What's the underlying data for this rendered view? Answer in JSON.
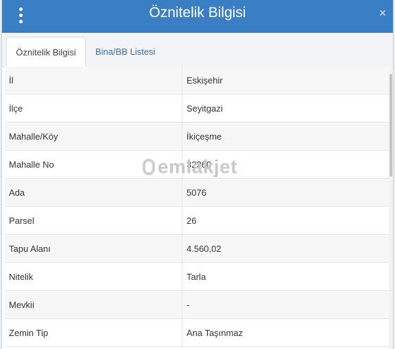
{
  "header": {
    "title": "Öznitelik Bilgisi",
    "close_glyph": "×",
    "menu_icon": "vertical-dots-icon"
  },
  "tabs": [
    {
      "label": "Öznitelik Bilgisi",
      "active": true
    },
    {
      "label": "Bina/BB Listesi",
      "active": false
    }
  ],
  "rows": [
    {
      "key": "İl",
      "value": "Eskişehir"
    },
    {
      "key": "İlçe",
      "value": "Seyitgazi"
    },
    {
      "key": "Mahalle/Köy",
      "value": "İkiçeşme"
    },
    {
      "key": "Mahalle No",
      "value": "32260"
    },
    {
      "key": "Ada",
      "value": "5076"
    },
    {
      "key": "Parsel",
      "value": "26"
    },
    {
      "key": "Tapu Alanı",
      "value": "4.560,02"
    },
    {
      "key": "Nitelik",
      "value": "Tarla"
    },
    {
      "key": "Mevkii",
      "value": "-"
    },
    {
      "key": "Zemin Tip",
      "value": "Ana Taşınmaz"
    }
  ],
  "watermark": "emlakjet",
  "colors": {
    "header_bg": "#3a7fc4",
    "tab_link": "#2f6fb0"
  }
}
